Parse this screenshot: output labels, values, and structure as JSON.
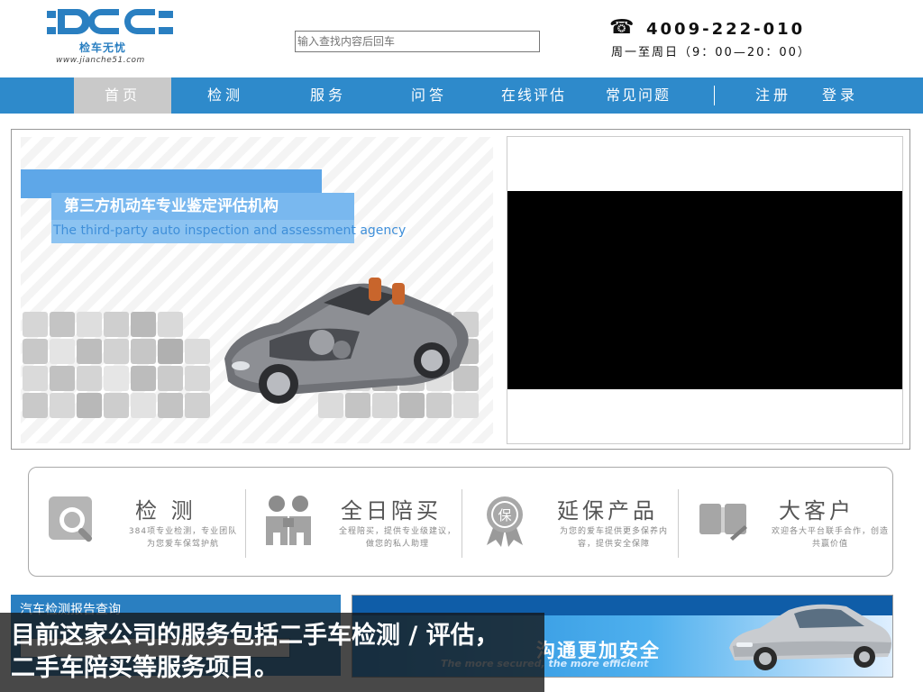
{
  "header": {
    "logo_text": "DCC",
    "logo_sub": "检车无忧",
    "logo_url": "www.jianche51.com",
    "search_placeholder": "输入查找内容后回车",
    "phone_icon": "telephone-icon",
    "phone": "4009-222-010",
    "hours": "周一至周日（9：00—20：00）"
  },
  "nav": {
    "items": [
      {
        "label": "首页",
        "active": true
      },
      {
        "label": "检测"
      },
      {
        "label": "服务"
      },
      {
        "label": "问答"
      },
      {
        "label": "在线评估"
      },
      {
        "label": "常见问题"
      },
      {
        "label": "注册"
      },
      {
        "label": "登录"
      }
    ]
  },
  "banner": {
    "title_cn": "第三方机动车专业鉴定评估机构",
    "title_en": "The third-party auto inspection and assessment agency"
  },
  "features": [
    {
      "icon": "magnifier-icon",
      "title": "检 测",
      "desc": "384项专业检测，专业团队为您爱车保驾护航"
    },
    {
      "icon": "people-icon",
      "title": "全日陪买",
      "desc": "全程陪买，提供专业级建议，做您的私人助理"
    },
    {
      "icon": "badge-icon",
      "icon_label": "保",
      "title": "延保产品",
      "desc": "为您的爱车提供更多保养内容，提供安全保障"
    },
    {
      "icon": "handshake-icon",
      "title": "大客户",
      "desc": "欢迎各大平台联手合作，创造共赢价值"
    }
  ],
  "report": {
    "title": "汽车检测报告查询"
  },
  "ad": {
    "text": "沟通更加安全",
    "text_en": "The more secured, the more efficient"
  },
  "caption": {
    "line1": "目前这家公司的服务包括二手车检测 / 评估，",
    "line2": "二手车陪买等服务项目。"
  },
  "colors": {
    "nav_blue": "#2e8acb",
    "active_gray": "#c9c9c9",
    "brand_blue": "#2a7fc1"
  }
}
